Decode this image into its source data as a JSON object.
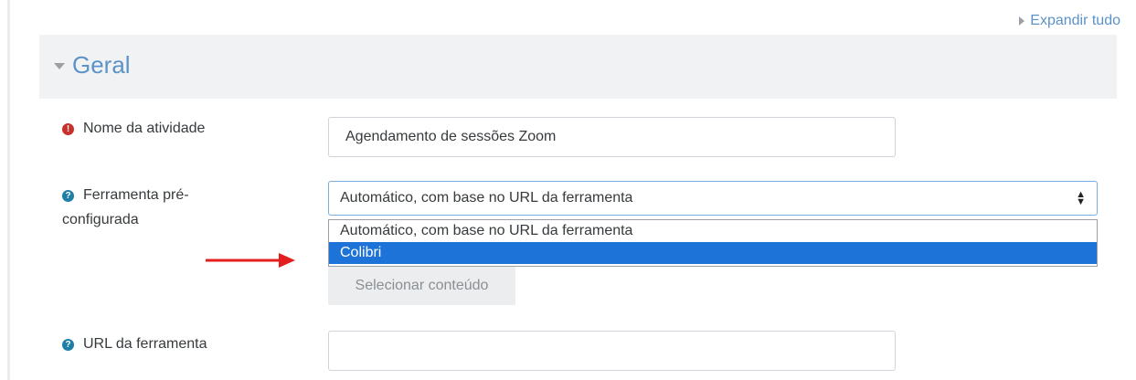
{
  "page": {
    "expand_all": "Expandir tudo"
  },
  "section": {
    "title": "Geral",
    "fields": {
      "activity_name": {
        "label": "Nome da atividade",
        "value": "Agendamento de sessões Zoom"
      },
      "preconfigured_tool": {
        "label_line1": "Ferramenta pré-",
        "label_line2": "configurada",
        "selected": "Automático, com base no URL da ferramenta",
        "options": [
          "Automático, com base no URL da ferramenta",
          "Colibri"
        ],
        "highlighted_option": "Colibri"
      },
      "select_content": {
        "button_label": "Selecionar conteúdo"
      },
      "tool_url": {
        "label": "URL da ferramenta",
        "value": ""
      }
    }
  },
  "colors": {
    "accent": "#5b93c8",
    "required": "#c9302c",
    "help": "#1d7ea8",
    "highlight": "#1e73d8",
    "arrow": "#e41e1e"
  }
}
